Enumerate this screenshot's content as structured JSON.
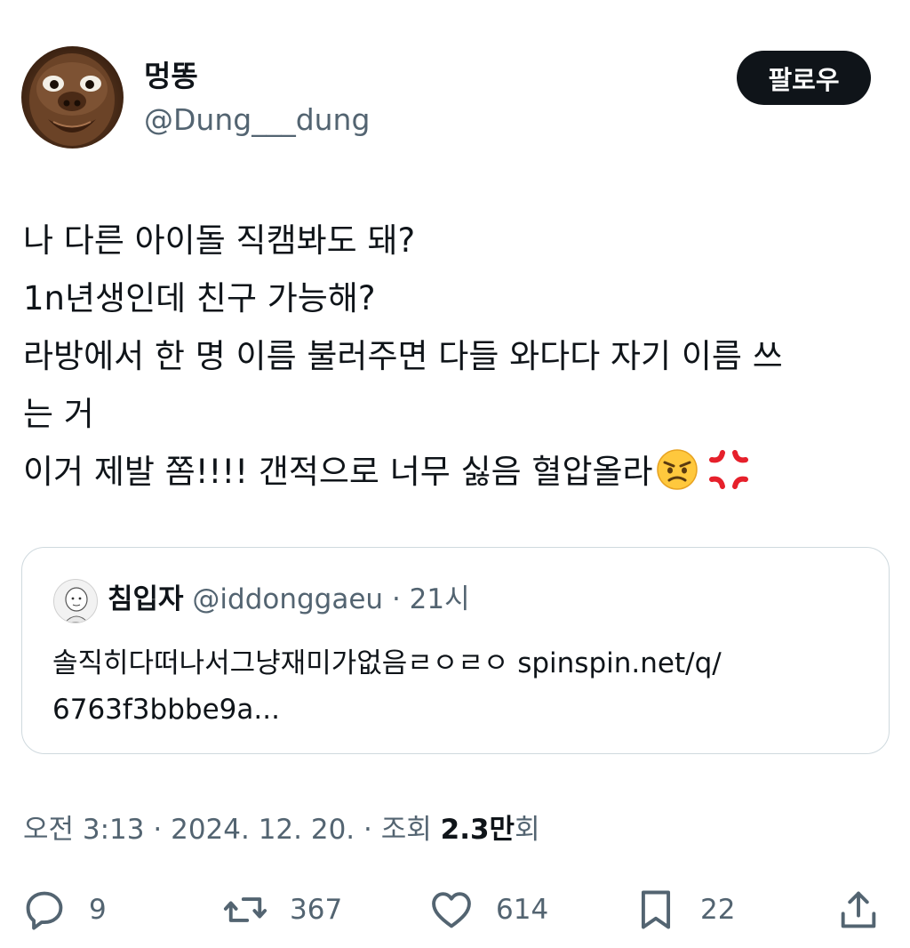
{
  "author": {
    "display_name": "멍똥",
    "handle": "@Dung___dung"
  },
  "follow_label": "팔로우",
  "tweet_lines": [
    "나 다른 아이돌 직캠봐도 돼?",
    "1n년생인데 친구 가능해?",
    "라방에서 한 명 이름 불러주면 다들 와다다 자기 이름 쓰",
    "는 거",
    "이거 제발 쫌!!!! 갠적으로 너무 싫음 혈압올라"
  ],
  "tweet_emojis": [
    "angry-face-emoji",
    "anger-symbol-emoji"
  ],
  "quote": {
    "name": "침입자",
    "handle": "@iddonggaeu",
    "separator": "·",
    "time": "21시",
    "text_lines": [
      "솔직히다떠나서그냥재미가없음ㄹㅇㄹㅇ spinspin.net/q/",
      "6763f3bbbe9a..."
    ]
  },
  "meta": {
    "time": "오전 3:13",
    "separator": "·",
    "date": "2024. 12. 20.",
    "views_label": "조회",
    "views_count": "2.3만",
    "views_suffix": "회"
  },
  "actions": {
    "replies": "9",
    "retweets": "367",
    "likes": "614",
    "bookmarks": "22"
  },
  "colors": {
    "text": "#0f1419",
    "secondary": "#536471",
    "border": "#cfd9de",
    "button_bg": "#0f1419"
  }
}
